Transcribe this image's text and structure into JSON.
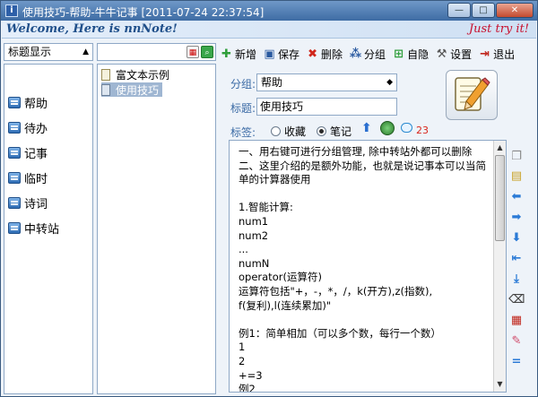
{
  "window": {
    "title": "使用技巧-帮助-牛牛记事 [2011-07-24 22:37:54]",
    "minimize_label": "—",
    "maximize_label": "□",
    "close_label": "✕"
  },
  "banner": {
    "welcome": "Welcome, Here is nnNote!",
    "tryit": "Just try it!"
  },
  "left": {
    "view_select": "标题显示",
    "categories": [
      "帮助",
      "待办",
      "记事",
      "临时",
      "诗词",
      "中转站"
    ]
  },
  "middle": {
    "search_value": "",
    "notes": [
      "富文本示例",
      "使用技巧"
    ],
    "selected_index": 1
  },
  "toolbar": {
    "new": "新增",
    "save": "保存",
    "delete": "删除",
    "group": "分组",
    "hide": "自隐",
    "settings": "设置",
    "exit": "退出"
  },
  "form": {
    "group_label": "分组:",
    "group_value": "帮助",
    "title_label": "标题:",
    "title_value": "使用技巧",
    "tags_label": "标签:",
    "tag_favorite": "收藏",
    "tag_note": "笔记",
    "comment_count": "23"
  },
  "editor": {
    "lines": [
      "一、用右键可进行分组管理, 除中转站外都可以删除",
      "二、这里介绍的是额外功能，也就是说记事本可以当简",
      "单的计算器使用",
      "",
      "1.智能计算:",
      "num1",
      "num2",
      "...",
      "numN",
      "operator(运算符)",
      "运算符包括\"+，-，*，/，k(开方),z(指数),",
      "f(复利),l(连续累加)\"",
      "",
      "例1：简单相加（可以多个数，每行一个数）",
      "1",
      "2",
      "+=3",
      "例2"
    ]
  },
  "colors": {
    "accent": "#3a6aa5",
    "banner_text": "#1f4f8a",
    "tryit": "#c8102e",
    "comment_count": "#d9261c"
  }
}
